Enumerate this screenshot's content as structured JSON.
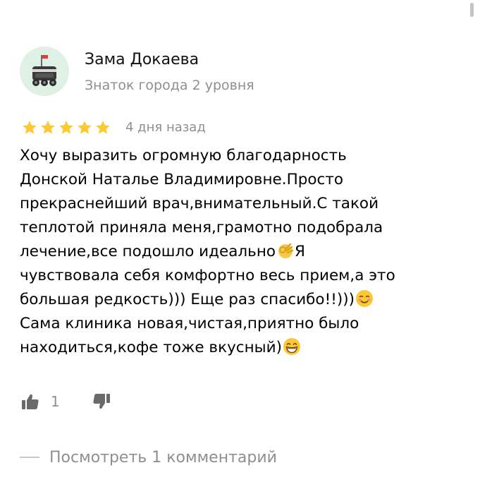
{
  "author": {
    "name": "Зама Докаева",
    "level": "Знаток города 2 уровня",
    "avatar_icon": "delivery-robot-icon"
  },
  "review": {
    "rating": 5,
    "rating_max": 5,
    "star_color": "#fcc934",
    "date": "4 дня назад",
    "lines": [
      "Хочу выразить огромную благодарность",
      "Донской Наталье Владимировне.Просто",
      "прекраснейший врач,внимательный.С такой",
      "теплотой приняла меня,грамотно подобрала",
      "лечение,все подошло идеально",
      "Я",
      "чувствовала себя комфортно весь прием,а это",
      "большая редкость))) Еще раз спасибо!!)))",
      "Сама клиника новая,чистая,приятно было",
      "находиться,кофе тоже вкусный)"
    ],
    "emojis": [
      "ok-hand-icon",
      "smiling-face-icon",
      "grinning-face-icon"
    ]
  },
  "reactions": {
    "like_count": "1",
    "like_icon": "thumbs-up-icon",
    "dislike_icon": "thumbs-down-icon"
  },
  "comments": {
    "label": "Посмотреть 1 комментарий"
  }
}
